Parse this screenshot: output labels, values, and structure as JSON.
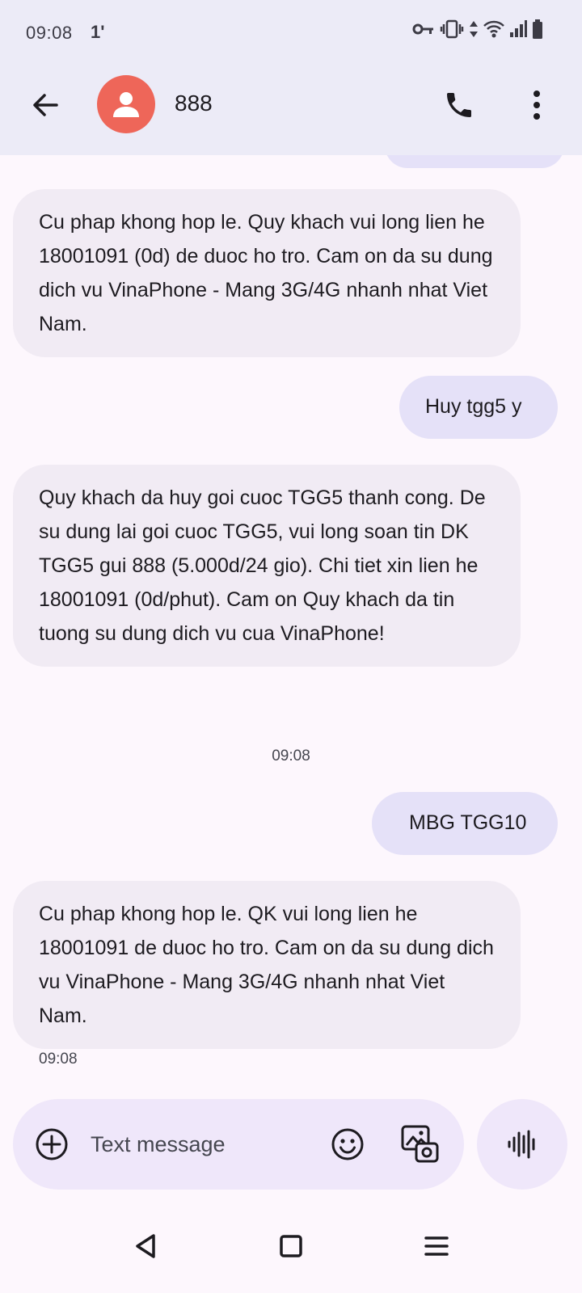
{
  "status_bar": {
    "time": "09:08",
    "notification": "1'"
  },
  "app_bar": {
    "contact_name": "888"
  },
  "messages": [
    {
      "direction": "incoming",
      "text": "Cu phap khong hop le. Quy khach vui long lien he 18001091 (0d) de duoc ho tro. Cam on da su dung dich vu VinaPhone - Mang 3G/4G nhanh nhat Viet Nam."
    },
    {
      "direction": "outgoing",
      "text": "Huy tgg5 y"
    },
    {
      "direction": "incoming",
      "text": "Quy khach da huy goi cuoc TGG5 thanh cong. De su dung lai goi cuoc TGG5, vui long soan tin DK TGG5 gui 888 (5.000d/24 gio). Chi tiet xin lien he 18001091 (0d/phut). Cam on Quy khach da tin tuong su dung dich vu cua VinaPhone!"
    },
    {
      "direction": "separator",
      "text": "09:08"
    },
    {
      "direction": "outgoing",
      "text": "MBG TGG10"
    },
    {
      "direction": "incoming",
      "text": "Cu phap khong hop le. QK vui long lien he 18001091 de duoc ho tro. Cam on da su dung dich vu VinaPhone - Mang 3G/4G nhanh nhat Viet Nam."
    },
    {
      "direction": "timestamp",
      "text": "09:08"
    }
  ],
  "composer": {
    "placeholder": "Text message"
  },
  "icons": {
    "back": "arrow-left-icon",
    "avatar": "person-icon",
    "call": "phone-icon",
    "more": "more-vert-icon",
    "add": "plus-circle-icon",
    "emoji": "emoji-icon",
    "gallery": "gallery-icon",
    "voice": "waveform-icon"
  },
  "colors": {
    "header_bg": "#ecebf7",
    "avatar": "#ee6659",
    "incoming_bubble": "#f1ebf4",
    "outgoing_bubble": "#e5e1f8",
    "composer_bg": "#efe7fa"
  }
}
